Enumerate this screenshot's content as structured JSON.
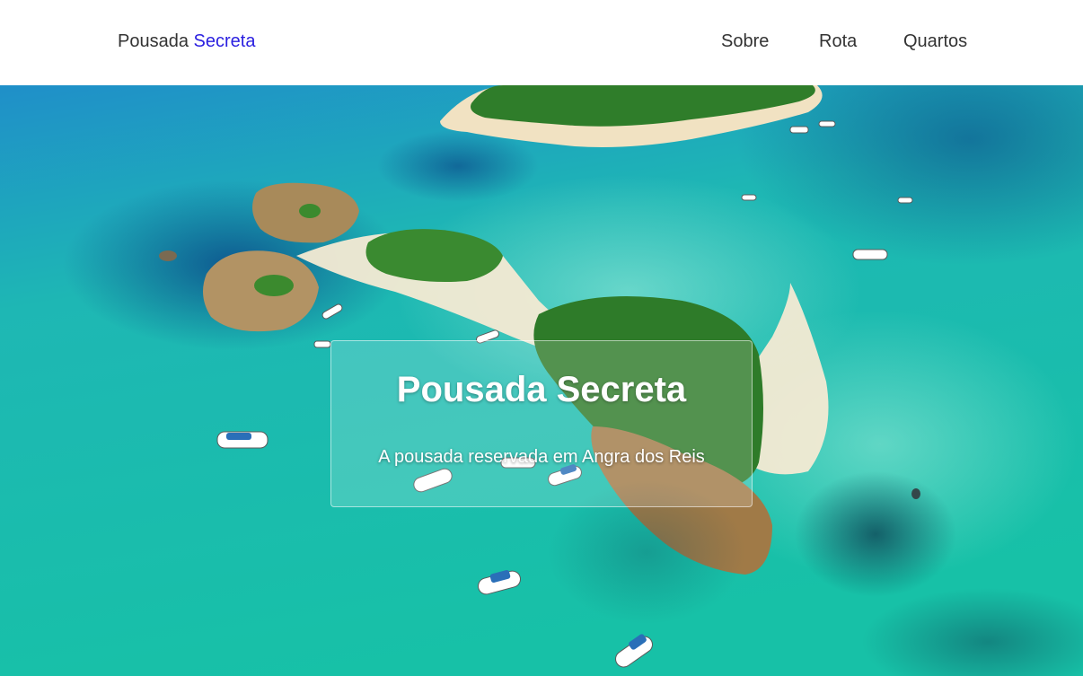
{
  "header": {
    "brand_first": "Pousada",
    "brand_accent": "Secreta",
    "nav": [
      {
        "label": "Sobre"
      },
      {
        "label": "Rota"
      },
      {
        "label": "Quartos"
      }
    ]
  },
  "hero": {
    "title": "Pousada Secreta",
    "subtitle": "A pousada reservada em Angra dos Reis",
    "image_subject": "aerial view of tropical islands with turquoise sea and boats"
  },
  "colors": {
    "brand_accent": "#2a1fe0",
    "nav_text": "#333333",
    "sea": "#19b7b0",
    "deep_sea": "#0f6aa8",
    "forest": "#2f7d2a",
    "sand": "#f3e7cf"
  }
}
